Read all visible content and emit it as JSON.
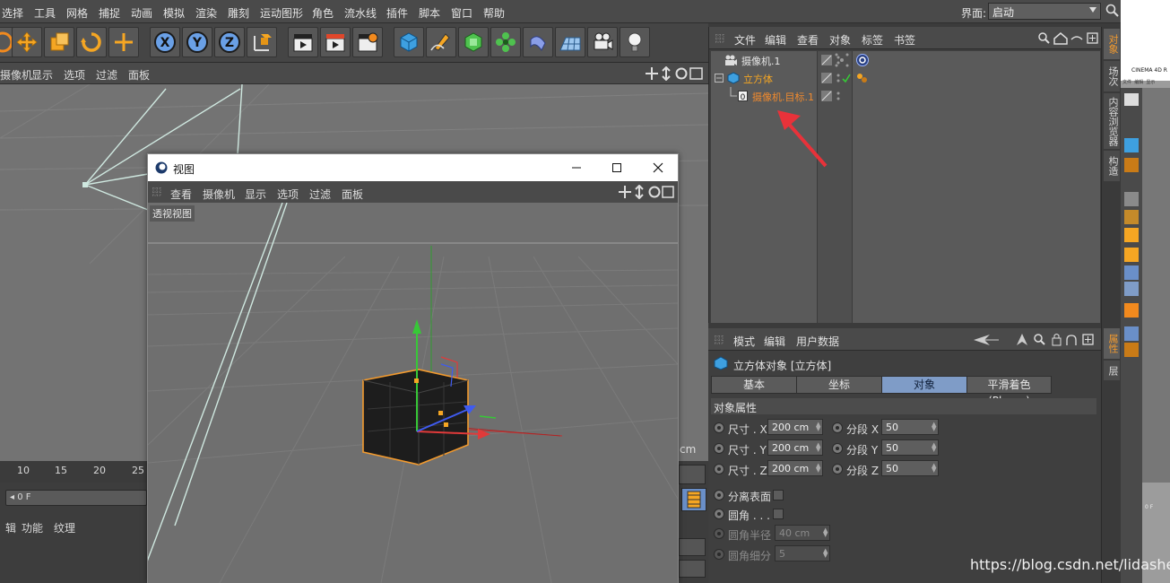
{
  "menubar": {
    "items": [
      "选择",
      "工具",
      "网格",
      "捕捉",
      "动画",
      "模拟",
      "渲染",
      "雕刻",
      "运动图形",
      "角色",
      "流水线",
      "插件",
      "脚本",
      "窗口",
      "帮助"
    ],
    "layout_label": "界面:",
    "layout_value": "启动"
  },
  "viewport_menu": {
    "items": [
      "摄像机",
      "显示",
      "选项",
      "过滤",
      "面板"
    ]
  },
  "timeline": {
    "ticks": [
      "10",
      "15",
      "20",
      "25"
    ],
    "frame_field": "0 F",
    "unit": "cm",
    "bottom_menu": [
      "辑",
      "功能",
      "纹理"
    ]
  },
  "popup_window": {
    "title": "视图",
    "menu": [
      "查看",
      "摄像机",
      "显示",
      "选项",
      "过滤",
      "面板"
    ],
    "viewport_label": "透视视图"
  },
  "object_manager": {
    "menu": [
      "文件",
      "编辑",
      "查看",
      "对象",
      "标签",
      "书签"
    ],
    "objects": [
      {
        "name": "摄像机.1",
        "color": "#e6e6e6"
      },
      {
        "name": "立方体",
        "color": "#f5a623"
      },
      {
        "name": "摄像机.目标.1",
        "color": "#f08a2e"
      }
    ],
    "annotation_color": "#e8323a"
  },
  "attribute_manager": {
    "menu": [
      "模式",
      "编辑",
      "用户数据"
    ],
    "object_title": "立方体对象 [立方体]",
    "tabs": [
      "基本",
      "坐标",
      "对象",
      "平滑着色(Phong)"
    ],
    "active_tab": "对象",
    "section": "对象属性",
    "size": [
      {
        "label": "尺寸 . X",
        "value": "200 cm"
      },
      {
        "label": "尺寸 . Y",
        "value": "200 cm"
      },
      {
        "label": "尺寸 . Z",
        "value": "200 cm"
      }
    ],
    "segments": [
      {
        "label": "分段 X",
        "value": "50"
      },
      {
        "label": "分段 Y",
        "value": "50"
      },
      {
        "label": "分段 Z",
        "value": "50"
      }
    ],
    "separate_surfaces": "分离表面",
    "fillet": "圆角 . . .",
    "fillet_radius": {
      "label": "圆角半径",
      "value": "40 cm"
    },
    "fillet_subdivision": {
      "label": "圆角细分",
      "value": "5"
    }
  },
  "side_tabs": [
    "对象",
    "场次",
    "内容浏览器",
    "构造",
    "属性",
    "层"
  ],
  "right_strip": {
    "title": "CINEMA 4D R",
    "menu": [
      "文件",
      "编辑",
      "显示"
    ],
    "frame": "0 F"
  },
  "watermark": "https://blog.csdn.net/lidashent",
  "colors": {
    "accent_orange": "#f29a2e",
    "active_tab_blue": "#7f9cc7",
    "axis_green": "#37c837",
    "axis_red": "#e03a3a",
    "axis_blue": "#3f5bf0"
  }
}
